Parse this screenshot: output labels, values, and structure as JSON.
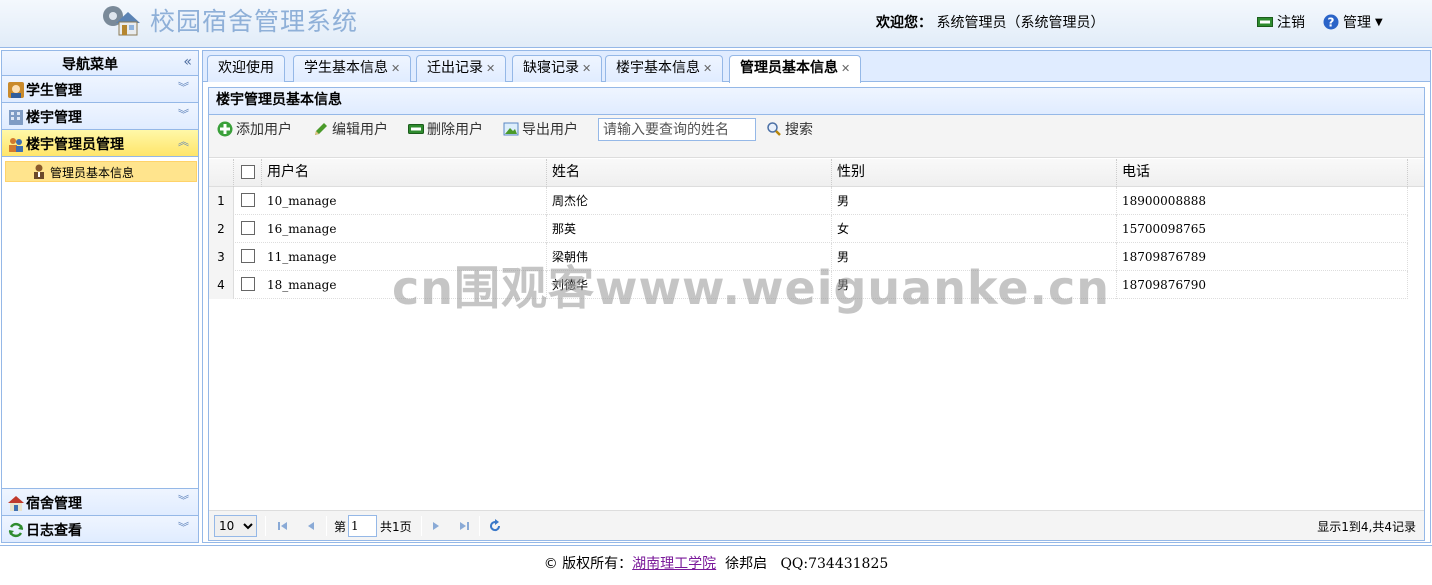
{
  "header": {
    "app_title": "校园宿舍管理系统",
    "welcome_label": "欢迎您：",
    "welcome_user": "系统管理员（系统管理员）",
    "logout_label": "注销",
    "manage_label": "管理"
  },
  "nav": {
    "title": "导航菜单",
    "collapse_glyph": "«",
    "sections": [
      {
        "label": "学生管理",
        "icon": "student-icon"
      },
      {
        "label": "楼宇管理",
        "icon": "building-icon"
      },
      {
        "label": "楼宇管理员管理",
        "icon": "admins-icon"
      }
    ],
    "active_sub_item": {
      "label": "管理员基本信息",
      "icon": "admin-person-icon"
    },
    "bottom_sections": [
      {
        "label": "宿舍管理",
        "icon": "dorm-icon"
      },
      {
        "label": "日志查看",
        "icon": "log-icon"
      }
    ]
  },
  "tabs": [
    {
      "label": "欢迎使用",
      "closable": false
    },
    {
      "label": "学生基本信息",
      "closable": true
    },
    {
      "label": "迁出记录",
      "closable": true
    },
    {
      "label": "缺寝记录",
      "closable": true
    },
    {
      "label": "楼宇基本信息",
      "closable": true
    },
    {
      "label": "管理员基本信息",
      "closable": true,
      "selected": true
    }
  ],
  "panel": {
    "title": "楼宇管理员基本信息",
    "toolbar": {
      "add": "添加用户",
      "edit": "编辑用户",
      "delete": "删除用户",
      "export": "导出用户",
      "search_placeholder": "请输入要查询的姓名",
      "search": "搜索"
    }
  },
  "grid": {
    "columns": [
      "用户名",
      "姓名",
      "性别",
      "电话"
    ],
    "rows": [
      {
        "num": "1",
        "username": "10_manage",
        "name": "周杰伦",
        "gender": "男",
        "phone": "18900008888"
      },
      {
        "num": "2",
        "username": "16_manage",
        "name": "那英",
        "gender": "女",
        "phone": "15700098765"
      },
      {
        "num": "3",
        "username": "11_manage",
        "name": "梁朝伟",
        "gender": "男",
        "phone": "18709876789"
      },
      {
        "num": "4",
        "username": "18_manage",
        "name": "刘德华",
        "gender": "男",
        "phone": "18709876790"
      }
    ]
  },
  "pager": {
    "page_size": "10",
    "page_prefix": "第",
    "page_value": "1",
    "page_suffix": "共1页",
    "info": "显示1到4,共4记录"
  },
  "footer": {
    "copyright": "© 版权所有：",
    "school_link": "湖南理工学院",
    "author": "徐邦启",
    "qq": "QQ:734431825"
  },
  "watermark": "cn围观客www.weiguanke.cn",
  "colors": {
    "border": "#95b8e7",
    "active_nav": "#ffe48d",
    "title_blue": "#8fb0d8"
  }
}
